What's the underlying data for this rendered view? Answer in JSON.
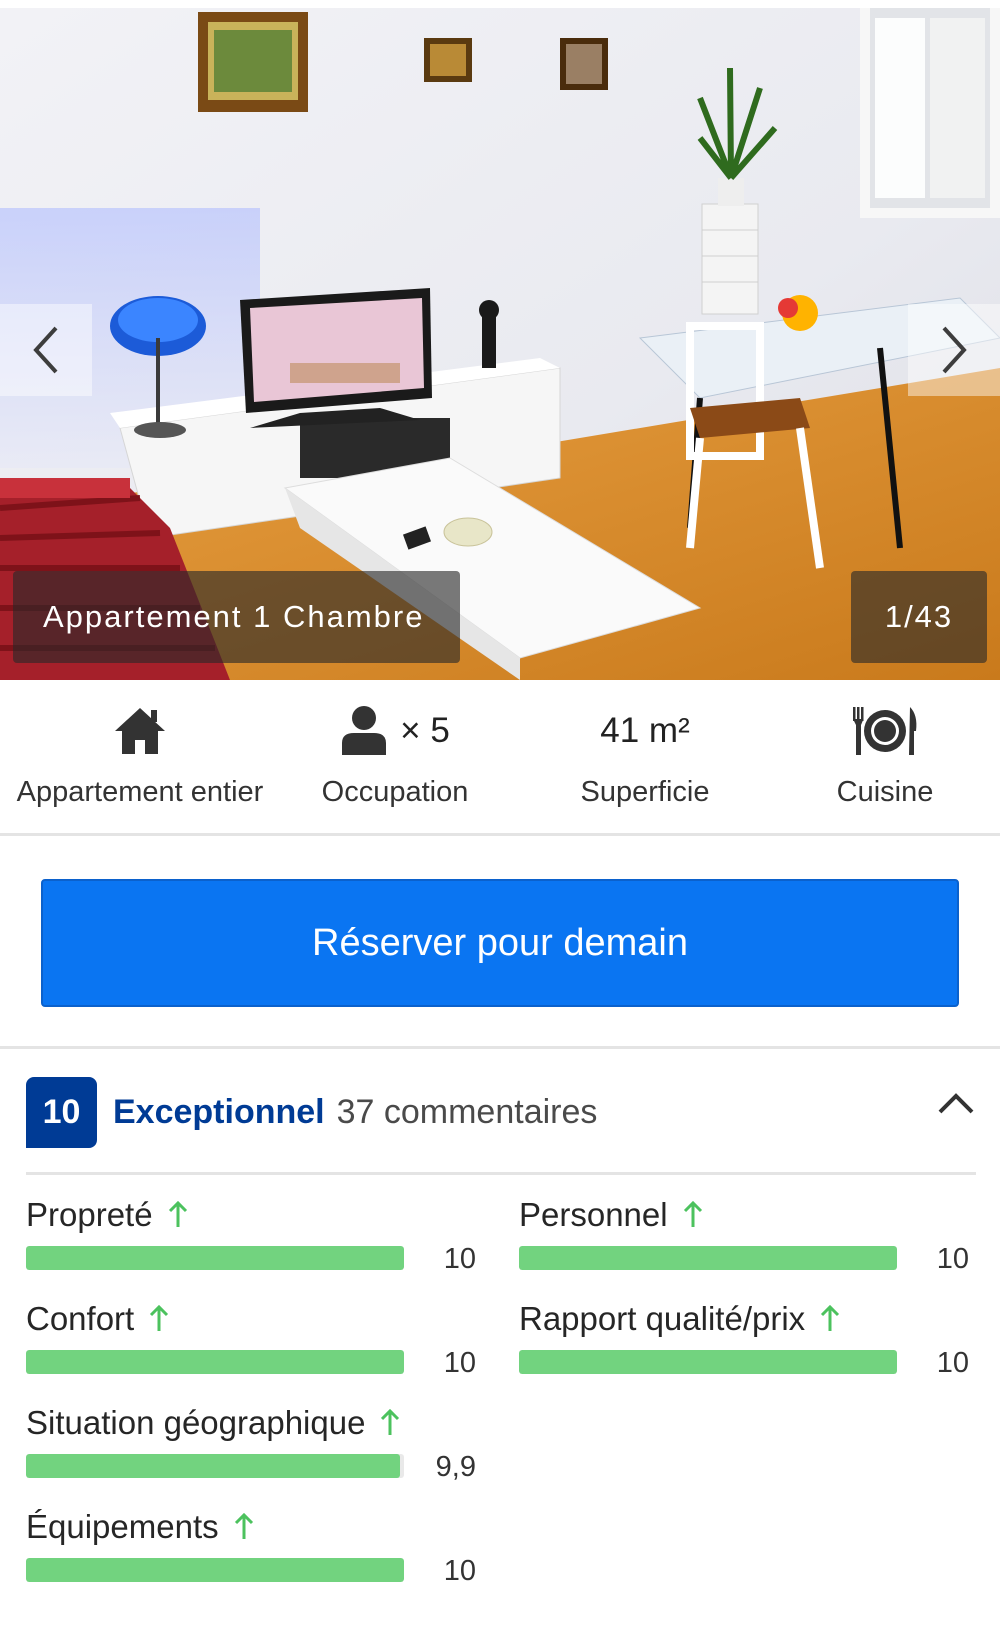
{
  "gallery": {
    "caption": "Appartement 1 Chambre",
    "counter": "1/43",
    "prev_icon": "chevron-left-icon",
    "next_icon": "chevron-right-icon"
  },
  "facilities": {
    "entire": {
      "label": "Appartement entier",
      "icon": "house-icon"
    },
    "occupancy": {
      "label": "Occupation",
      "value": "× 5",
      "icon": "person-icon"
    },
    "area": {
      "label": "Superficie",
      "value": "41 m²"
    },
    "kitchen": {
      "label": "Cuisine",
      "icon": "plate-cutlery-icon"
    }
  },
  "reserve": {
    "label": "Réserver pour demain",
    "color": "#0a75f2"
  },
  "reviews": {
    "score": "10",
    "score_word": "Exceptionnel",
    "count_text": "37 commentaires",
    "badge_color": "#003b95",
    "bar_color": "#72d37f",
    "categories": [
      {
        "label": "Propreté",
        "value": "10",
        "fraction": 1.0
      },
      {
        "label": "Personnel",
        "value": "10",
        "fraction": 1.0
      },
      {
        "label": "Confort",
        "value": "10",
        "fraction": 1.0
      },
      {
        "label": "Rapport qualité/prix",
        "value": "10",
        "fraction": 1.0
      },
      {
        "label": "Situation géographique",
        "value": "9,9",
        "fraction": 0.99
      },
      {
        "label": "Équipements",
        "value": "10",
        "fraction": 1.0
      }
    ]
  }
}
